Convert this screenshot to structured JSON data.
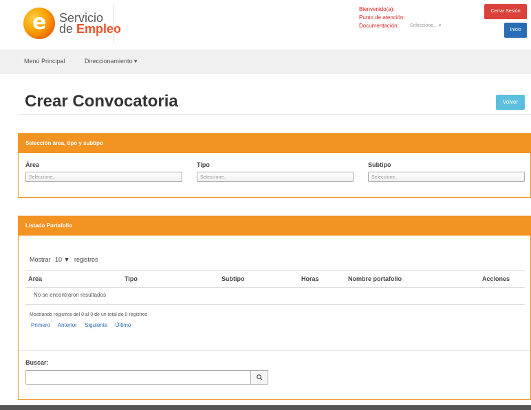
{
  "brand": {
    "line1": "Servicio",
    "line2_prefix": "de ",
    "line2_accent": "Empleo",
    "logo_letter": "e"
  },
  "user": {
    "welcome": "Bienvenido(a):",
    "attention_point": "Punto de atención:",
    "documentation": "Documentación:",
    "documentation_value": "Seleccione... ▾"
  },
  "header": {
    "logout_label": "Cerrar Sesión",
    "home_label": "Inicio"
  },
  "nav": {
    "items": [
      "Menú Principal",
      "Direccionamiento ▾"
    ]
  },
  "page": {
    "title": "Crear Convocatoria",
    "back_label": "Volver"
  },
  "selection_panel": {
    "title": "Selección área, tipo y subtipo",
    "fields": [
      {
        "label": "Área",
        "placeholder": "Seleccione.."
      },
      {
        "label": "Tipo",
        "placeholder": "Seleccione.."
      },
      {
        "label": "Subtipo",
        "placeholder": "Seleccione.."
      }
    ]
  },
  "portfolio_panel": {
    "title": "Listado Portafolio",
    "show_prefix": "Mostrar",
    "show_value": "10",
    "show_arrow": "▼",
    "show_suffix": "registros",
    "columns": [
      "Area",
      "Tipo",
      "Subtipo",
      "Horas",
      "Nombre portafolio",
      "Acciones"
    ],
    "empty_message": "No se encontraron resultados",
    "info": "Mostrando registros del 0 al 0 de un total de 0 registros",
    "pager": [
      "Primero",
      "Anterior",
      "Siguiente",
      "Último"
    ],
    "search_label": "Buscar:",
    "search_icon": "search-icon"
  }
}
